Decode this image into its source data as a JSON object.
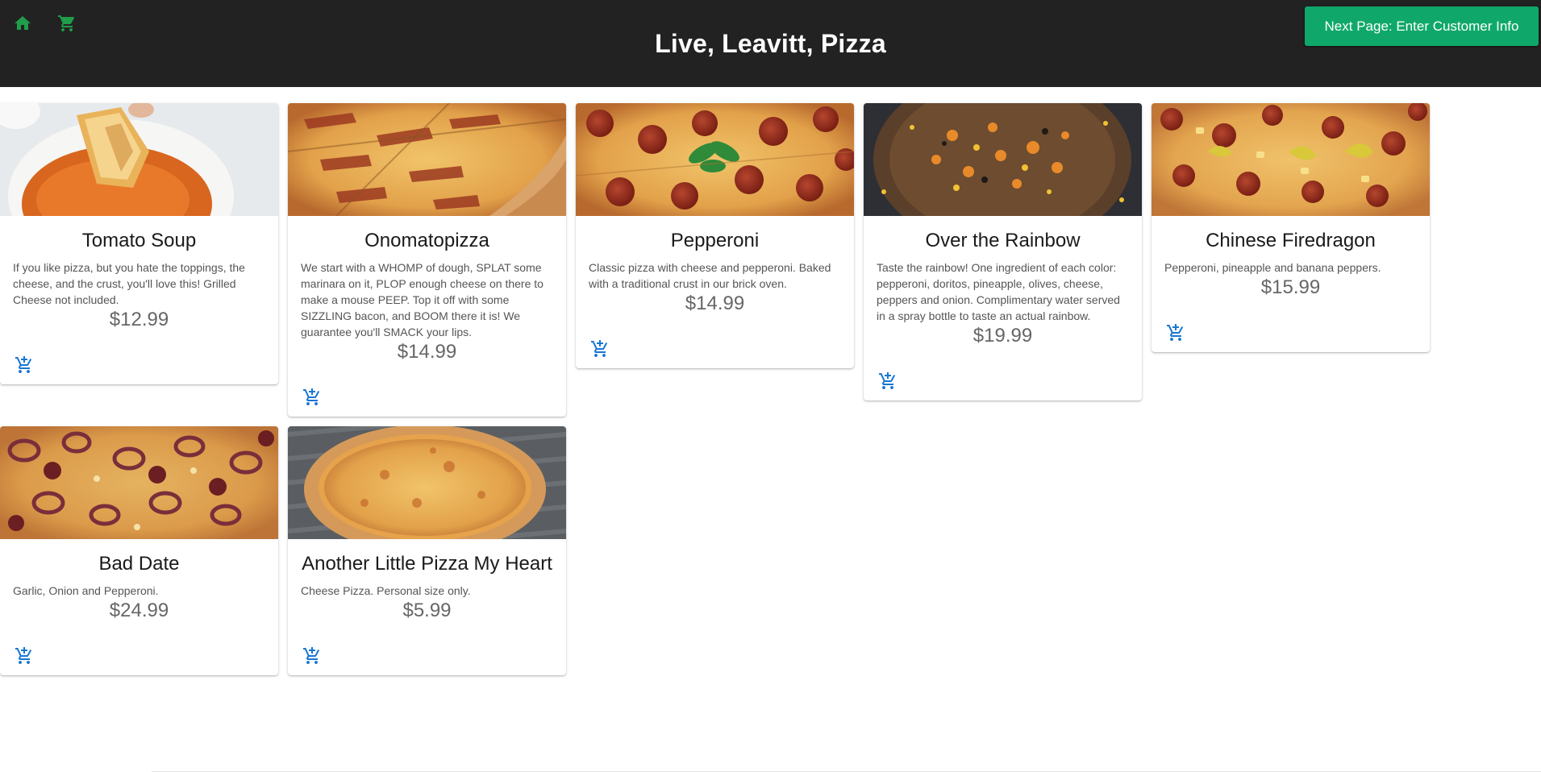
{
  "header": {
    "title": "Live, Leavitt, Pizza",
    "next_button_label": "Next Page: Enter Customer Info",
    "home_icon": "home-icon",
    "cart_icon": "shopping-cart-icon",
    "accent_color": "#1f9d4a",
    "button_color": "#0fa86a",
    "bar_color": "#222222"
  },
  "menu": {
    "items": [
      {
        "name": "Tomato Soup",
        "description": "If you like pizza, but you hate the toppings, the cheese, and the crust, you'll love this! Grilled Cheese not included.",
        "price": "$12.99",
        "image": "tomato-soup-photo",
        "action_icon": "add-to-cart-icon"
      },
      {
        "name": "Onomatopizza",
        "description": "We start with a WHOMP of dough, SPLAT some marinara on it, PLOP enough cheese on there to make a mouse PEEP. Top it off with some SIZZLING bacon, and BOOM there it is! We guarantee you'll SMACK your lips.",
        "price": "$14.99",
        "image": "bacon-pizza-photo",
        "action_icon": "add-to-cart-icon"
      },
      {
        "name": "Pepperoni",
        "description": "Classic pizza with cheese and pepperoni. Baked with a traditional crust in our brick oven.",
        "price": "$14.99",
        "image": "pepperoni-pizza-photo",
        "action_icon": "add-to-cart-icon"
      },
      {
        "name": "Over the Rainbow",
        "description": "Taste the rainbow! One ingredient of each color: pepperoni, doritos, pineapple, olives, cheese, peppers and onion. Complimentary water served in a spray bottle to taste an actual rainbow.",
        "price": "$19.99",
        "image": "rainbow-pizza-photo",
        "action_icon": "add-to-cart-icon"
      },
      {
        "name": "Chinese Firedragon",
        "description": "Pepperoni, pineapple and banana peppers.",
        "price": "$15.99",
        "image": "firedragon-pizza-photo",
        "action_icon": "add-to-cart-icon"
      },
      {
        "name": "Bad Date",
        "description": "Garlic, Onion and Pepperoni.",
        "price": "$24.99",
        "image": "garlic-onion-pizza-photo",
        "action_icon": "add-to-cart-icon"
      },
      {
        "name": "Another Little Pizza My Heart",
        "description": "Cheese Pizza. Personal size only.",
        "price": "$5.99",
        "image": "cheese-pizza-photo",
        "action_icon": "add-to-cart-icon"
      }
    ]
  }
}
